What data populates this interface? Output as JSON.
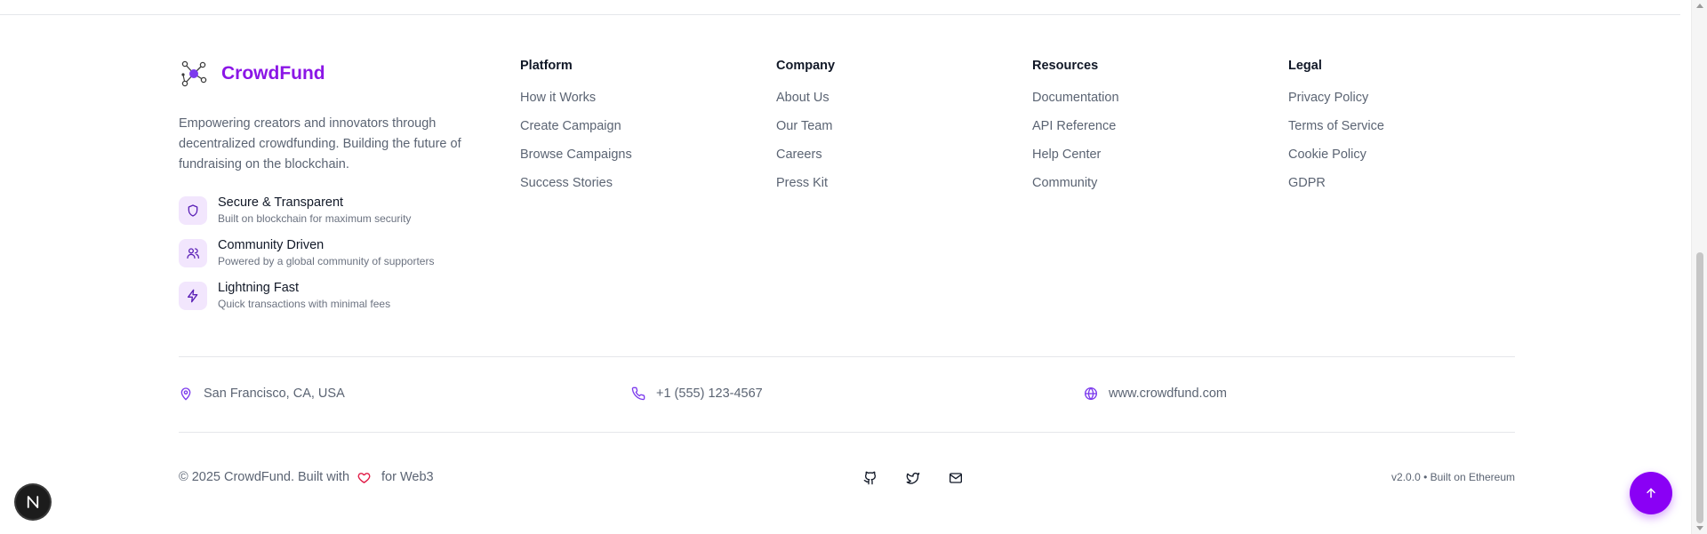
{
  "brand": {
    "name": "CrowdFund",
    "description": "Empowering creators and innovators through decentralized crowdfunding. Building the future of fundraising on the blockchain.",
    "accent_color": "#8b16e6"
  },
  "features": [
    {
      "icon": "shield-icon",
      "title": "Secure & Transparent",
      "desc": "Built on blockchain for maximum security"
    },
    {
      "icon": "users-icon",
      "title": "Community Driven",
      "desc": "Powered by a global community of supporters"
    },
    {
      "icon": "lightning-icon",
      "title": "Lightning Fast",
      "desc": "Quick transactions with minimal fees"
    }
  ],
  "columns": [
    {
      "title": "Platform",
      "links": [
        "How it Works",
        "Create Campaign",
        "Browse Campaigns",
        "Success Stories"
      ]
    },
    {
      "title": "Company",
      "links": [
        "About Us",
        "Our Team",
        "Careers",
        "Press Kit"
      ]
    },
    {
      "title": "Resources",
      "links": [
        "Documentation",
        "API Reference",
        "Help Center",
        "Community"
      ]
    },
    {
      "title": "Legal",
      "links": [
        "Privacy Policy",
        "Terms of Service",
        "Cookie Policy",
        "GDPR"
      ]
    }
  ],
  "contact": {
    "location": "San Francisco, CA, USA",
    "phone": "+1 (555) 123-4567",
    "website": "www.crowdfund.com"
  },
  "bottom": {
    "copyright_prefix": "© 2025 CrowdFund. Built with",
    "copyright_suffix": "for Web3",
    "version": "v2.0.0 • Built on Ethereum"
  },
  "socials": [
    "github-icon",
    "twitter-icon",
    "mail-icon"
  ],
  "colors": {
    "primary": "#8a00f5",
    "heart": "#e11d48",
    "icon_bg": "#f2e6fd"
  },
  "badge": {
    "letter": "N"
  }
}
